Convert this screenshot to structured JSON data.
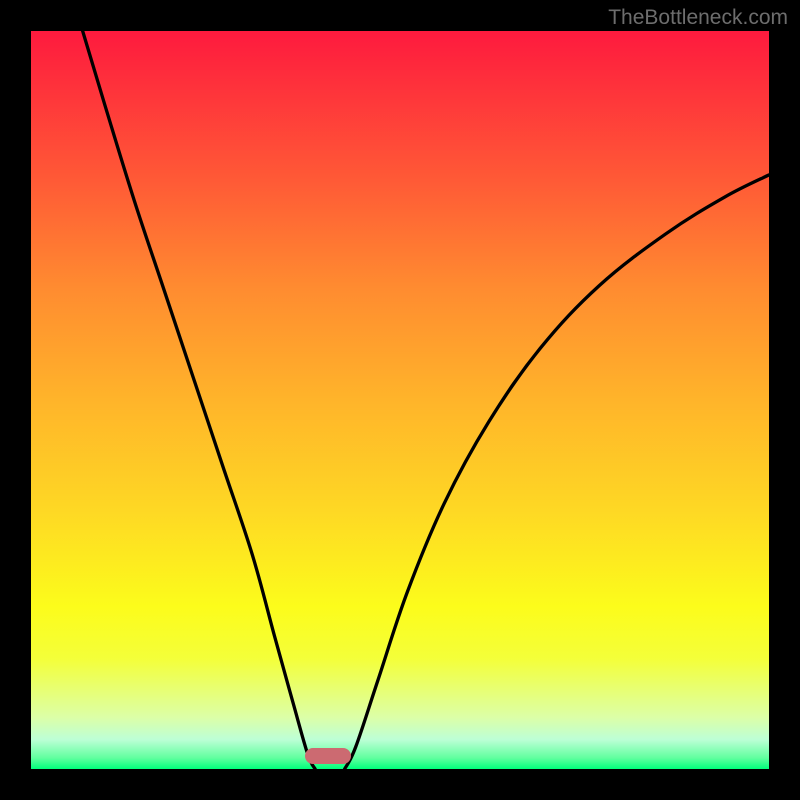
{
  "watermark": "TheBottleneck.com",
  "chart_data": {
    "type": "line",
    "title": "",
    "xlabel": "",
    "ylabel": "",
    "xlim": [
      0,
      100
    ],
    "ylim": [
      0,
      100
    ],
    "gradient_stops": [
      {
        "pos": 0,
        "color": "#fe1a3e"
      },
      {
        "pos": 20,
        "color": "#ff5936"
      },
      {
        "pos": 35,
        "color": "#ff8c30"
      },
      {
        "pos": 50,
        "color": "#ffb42a"
      },
      {
        "pos": 65,
        "color": "#fed824"
      },
      {
        "pos": 78,
        "color": "#fcfc1b"
      },
      {
        "pos": 85,
        "color": "#f4ff39"
      },
      {
        "pos": 93,
        "color": "#dcffa7"
      },
      {
        "pos": 96,
        "color": "#bdffd6"
      },
      {
        "pos": 98.5,
        "color": "#61ff9f"
      },
      {
        "pos": 100,
        "color": "#00ff7b"
      }
    ],
    "series": [
      {
        "name": "left-curve",
        "values": [
          {
            "x": 7.0,
            "y": 100.0
          },
          {
            "x": 10.0,
            "y": 90.0
          },
          {
            "x": 14.0,
            "y": 77.0
          },
          {
            "x": 18.0,
            "y": 65.0
          },
          {
            "x": 22.0,
            "y": 53.0
          },
          {
            "x": 26.0,
            "y": 41.0
          },
          {
            "x": 30.0,
            "y": 29.0
          },
          {
            "x": 33.0,
            "y": 18.0
          },
          {
            "x": 35.5,
            "y": 9.0
          },
          {
            "x": 37.5,
            "y": 2.0
          },
          {
            "x": 38.5,
            "y": 0.0
          }
        ]
      },
      {
        "name": "right-curve",
        "values": [
          {
            "x": 42.5,
            "y": 0.0
          },
          {
            "x": 44.0,
            "y": 3.0
          },
          {
            "x": 47.0,
            "y": 12.0
          },
          {
            "x": 51.0,
            "y": 24.0
          },
          {
            "x": 56.0,
            "y": 36.0
          },
          {
            "x": 62.0,
            "y": 47.0
          },
          {
            "x": 69.0,
            "y": 57.0
          },
          {
            "x": 77.0,
            "y": 65.5
          },
          {
            "x": 86.0,
            "y": 72.5
          },
          {
            "x": 94.0,
            "y": 77.5
          },
          {
            "x": 100.0,
            "y": 80.5
          }
        ]
      }
    ],
    "marker": {
      "x_center": 40.2,
      "y_center": 1.8,
      "width": 6.2,
      "height": 2.2,
      "color": "#cc6a71"
    }
  }
}
